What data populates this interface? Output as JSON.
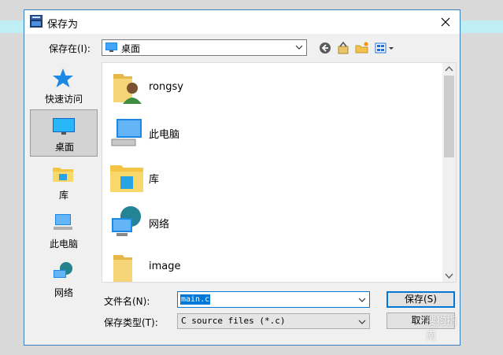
{
  "window": {
    "title": "保存为",
    "close_icon": "close-icon",
    "app_icon": "dev-cpp-icon"
  },
  "location": {
    "label": "保存在(I):",
    "value": "桌面"
  },
  "toolbar": {
    "back_icon": "back-arrow-icon",
    "up_icon": "up-folder-icon",
    "new_folder_icon": "new-folder-icon",
    "view_icon": "view-menu-icon"
  },
  "places": [
    {
      "label": "快速访问",
      "icon": "star-icon"
    },
    {
      "label": "桌面",
      "icon": "desktop-icon",
      "selected": true
    },
    {
      "label": "库",
      "icon": "library-icon"
    },
    {
      "label": "此电脑",
      "icon": "computer-icon"
    },
    {
      "label": "网络",
      "icon": "network-icon"
    }
  ],
  "files": [
    {
      "name": "rongsy",
      "icon": "user-folder-icon"
    },
    {
      "name": "此电脑",
      "icon": "computer-icon"
    },
    {
      "name": "库",
      "icon": "library-icon"
    },
    {
      "name": "网络",
      "icon": "network-icon"
    },
    {
      "name": "image",
      "icon": "folder-icon"
    }
  ],
  "form": {
    "filename_label": "文件名(N):",
    "filename_value": "main.c",
    "filetype_label": "保存类型(T):",
    "filetype_value": "C source files (*.c)"
  },
  "buttons": {
    "save": "保存(S)",
    "cancel": "取消"
  },
  "watermark": "搜狗指南",
  "colors": {
    "accent": "#0078d7",
    "border": "#3a7fbe"
  }
}
